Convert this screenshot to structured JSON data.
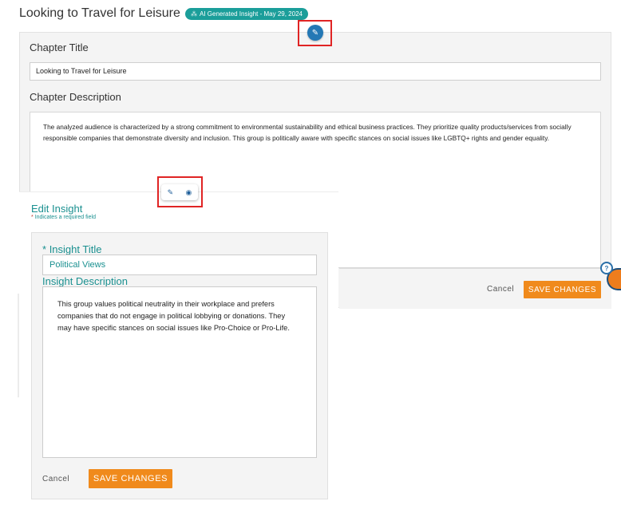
{
  "page": {
    "title": "Looking to Travel for Leisure",
    "ai_badge": "AI Generated Insight - May 29, 2024"
  },
  "chapter": {
    "title_label": "Chapter Title",
    "title_value": "Looking to Travel for Leisure",
    "description_label": "Chapter Description",
    "description_value": "The analyzed audience is characterized by a strong commitment to environmental sustainability and ethical business practices. They prioritize quality products/services from socially responsible companies that demonstrate diversity and inclusion. This group is politically aware with specific stances on social issues like LGBTQ+ rights and gender equality.",
    "cancel_label": "Cancel",
    "save_label": "SAVE CHANGES"
  },
  "insight": {
    "heading": "Edit Insight",
    "required_note": "Indicates a required field",
    "required_star": "*",
    "title_label": "Insight Title",
    "title_value": "Political Views",
    "description_label": "Insight Description",
    "description_value": "This group values political neutrality in their workplace and prefers companies that do not engage in political lobbying or donations. They may have specific stances on social issues like Pro-Choice or Pro-Life.",
    "cancel_label": "Cancel",
    "save_label": "SAVE CHANGES"
  },
  "icons": {
    "edit": "pencil-icon",
    "hide": "eye-slash-icon",
    "help": "question-icon",
    "ai": "sparkle-icon"
  },
  "colors": {
    "accent_teal": "#1b9e9a",
    "save_orange": "#f08a1c",
    "edit_blue": "#2478b5",
    "highlight_red": "#e02424"
  }
}
